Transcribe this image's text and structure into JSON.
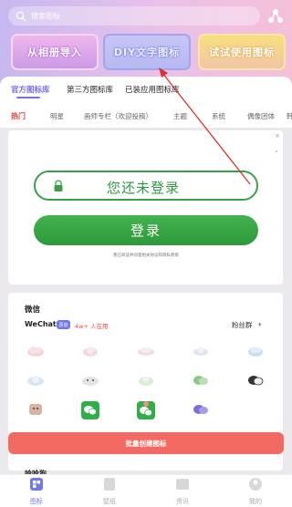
{
  "search": {
    "placeholder": "搜索图标"
  },
  "feature_tiles": [
    {
      "label": "从相册导入"
    },
    {
      "label": "DIY文字图标"
    },
    {
      "label": "试试使用图标"
    }
  ],
  "source_tabs": [
    {
      "label": "官方图标库",
      "active": true
    },
    {
      "label": "第三方图标库",
      "active": false
    },
    {
      "label": "已装应用图标库",
      "active": false
    }
  ],
  "category_tabs": [
    {
      "label": "热门",
      "active": true
    },
    {
      "label": "明星"
    },
    {
      "label": "画师专栏（欢迎投稿）"
    },
    {
      "label": "主题"
    },
    {
      "label": "系统"
    },
    {
      "label": "偶像团体"
    },
    {
      "label": "韩"
    }
  ],
  "login_card": {
    "close": "×",
    "status_text": "您还未登录",
    "login_button": "登录",
    "agreement": "我已阅读并同意相关协议和隐私政策"
  },
  "app_section": {
    "title": "微信",
    "app_name": "WeChat",
    "badge": "原创",
    "users": "4w+ 人在用",
    "fans_label": "粉丝群",
    "batch_button": "批量创建图标"
  },
  "next_section": {
    "title": "哈哈狗"
  },
  "bottom_nav": [
    {
      "label": "图标",
      "active": true
    },
    {
      "label": "壁纸"
    },
    {
      "label": "资讯"
    },
    {
      "label": "我的"
    }
  ],
  "colors": {
    "accent": "#6f79e8",
    "hot": "#e03a3a",
    "login_green": "#2f9a3f",
    "batch_red": "#f36a62"
  }
}
